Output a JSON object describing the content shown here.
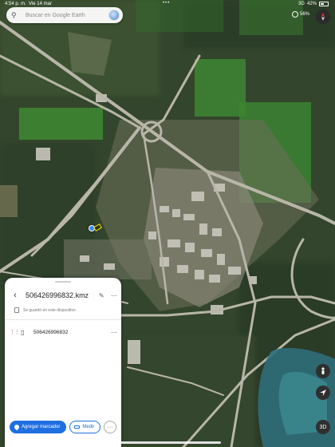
{
  "status_bar": {
    "time": "4:54 p. m.",
    "date": "Vie 14 mar",
    "dots": "•••",
    "signal": "3G",
    "battery": "42%"
  },
  "search": {
    "placeholder": "Buscar en Google Earth",
    "icon": "search-icon"
  },
  "map_controls": {
    "cloud_percent": "56%",
    "compass_icon": "compass-icon",
    "person_icon": "pegman-icon",
    "location_icon": "my-location-icon",
    "view_3d": "3D"
  },
  "sheet": {
    "title": "506426996832.kmz",
    "saved_note": "Se guardó en este dispositivo",
    "items": [
      {
        "name": "506426996832"
      }
    ],
    "add_marker_label": "Agregar marcador",
    "measure_label": "Medir",
    "more_label": "···"
  },
  "colors": {
    "accent": "#1f6fe0",
    "marker": "#ffe600",
    "location_dot": "#3a86f7"
  }
}
